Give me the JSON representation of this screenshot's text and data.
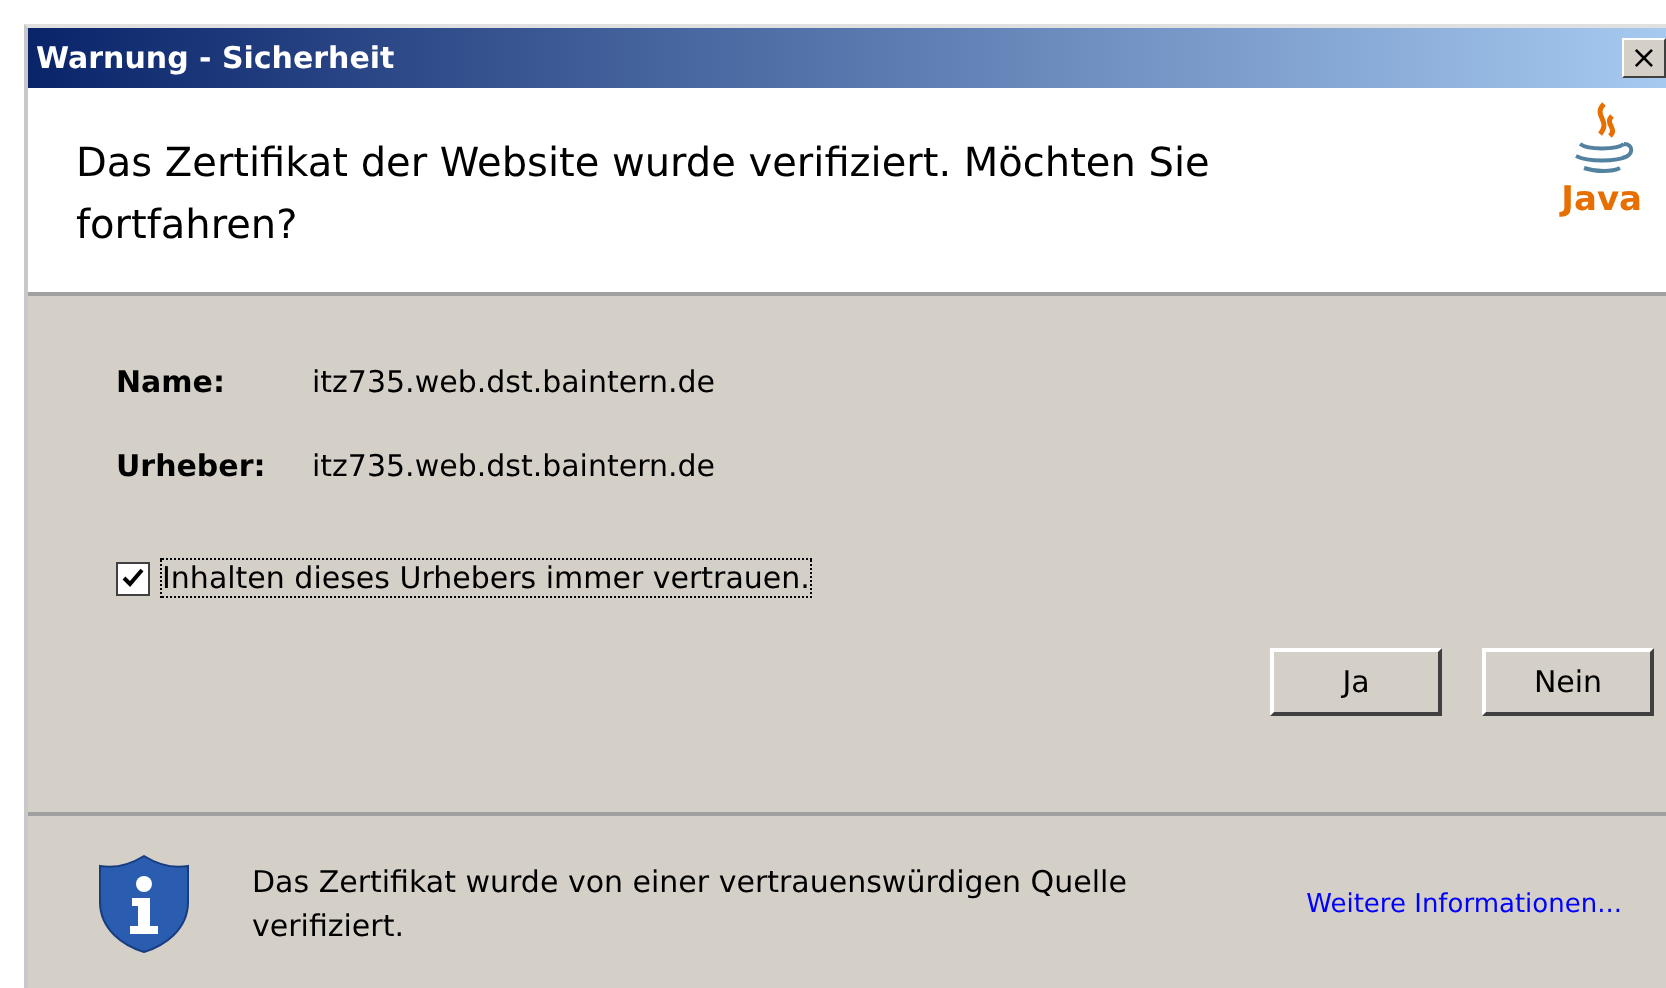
{
  "window": {
    "title": "Warnung - Sicherheit",
    "close": "×"
  },
  "header": {
    "message": "Das Zertifikat der Website wurde verifiziert.  Möchten Sie fortfahren?",
    "logo_text": "Java"
  },
  "fields": [
    {
      "label": "Name:",
      "value": "itz735.web.dst.baintern.de"
    },
    {
      "label": "Urheber:",
      "value": "itz735.web.dst.baintern.de"
    }
  ],
  "checkbox": {
    "label": "Inhalten dieses Urhebers immer vertrauen.",
    "checked": true
  },
  "buttons": [
    "Ja",
    "Nein"
  ],
  "footer": {
    "message": "Das Zertifikat wurde von einer vertrauenswürdigen Quelle verifiziert.",
    "link": "Weitere Informationen..."
  }
}
